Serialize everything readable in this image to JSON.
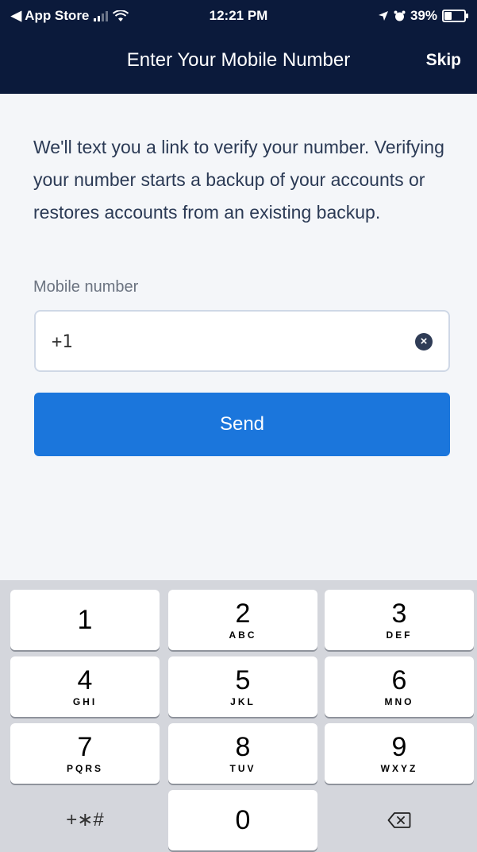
{
  "status_bar": {
    "back_app": "◀ App Store",
    "time": "12:21 PM",
    "battery": "39%",
    "battery_level": 0.39
  },
  "nav": {
    "title": "Enter Your Mobile Number",
    "skip_label": "Skip"
  },
  "intro_text": "We'll text you a link to verify your number. Verifying your number starts a backup of your accounts or restores accounts from an existing backup.",
  "form": {
    "field_label": "Mobile number",
    "value": "+1",
    "clear_icon": "×",
    "send_label": "Send"
  },
  "keypad": {
    "keys": [
      {
        "num": "1",
        "letters": ""
      },
      {
        "num": "2",
        "letters": "ABC"
      },
      {
        "num": "3",
        "letters": "DEF"
      },
      {
        "num": "4",
        "letters": "GHI"
      },
      {
        "num": "5",
        "letters": "JKL"
      },
      {
        "num": "6",
        "letters": "MNO"
      },
      {
        "num": "7",
        "letters": "PQRS"
      },
      {
        "num": "8",
        "letters": "TUV"
      },
      {
        "num": "9",
        "letters": "WXYZ"
      },
      {
        "num": "0",
        "letters": ""
      }
    ],
    "symbols_label": "+∗#",
    "delete_icon": "backspace-icon"
  },
  "colors": {
    "header": "#0b1a3b",
    "accent": "#1b76dc",
    "background": "#f4f6f9"
  }
}
